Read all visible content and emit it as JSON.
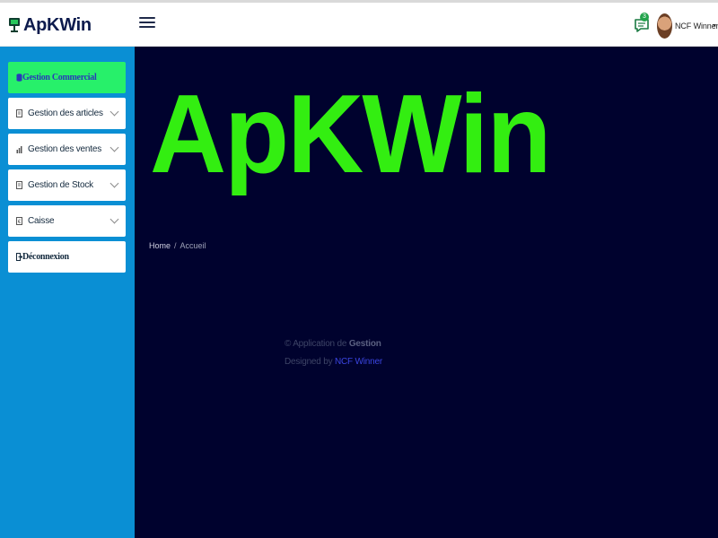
{
  "header": {
    "app_name": "ApKWin",
    "notification_count": "3",
    "user_name": "NCF Winner"
  },
  "sidebar": {
    "items": [
      {
        "label": "Gestion Commercial",
        "icon": "database-icon",
        "active": true,
        "has_submenu": false
      },
      {
        "label": "Gestion des articles",
        "icon": "document-icon",
        "active": false,
        "has_submenu": true
      },
      {
        "label": "Gestion des ventes",
        "icon": "bar-chart-icon",
        "active": false,
        "has_submenu": true
      },
      {
        "label": "Gestion de Stock",
        "icon": "document-icon",
        "active": false,
        "has_submenu": true
      },
      {
        "label": "Caisse",
        "icon": "cash-icon",
        "active": false,
        "has_submenu": true
      },
      {
        "label": "Déconnexion",
        "icon": "logout-icon",
        "active": false,
        "has_submenu": false
      }
    ]
  },
  "main": {
    "hero_title": "ApKWin",
    "breadcrumb": {
      "home": "Home",
      "separator": "/",
      "current": "Accueil"
    },
    "footer": {
      "copyright_prefix": "© Application de",
      "copyright_strong": "Gestion",
      "designed_by": "Designed by",
      "designer": "NCF Winner"
    }
  },
  "colors": {
    "header_bg": "#ffffff",
    "sidebar_bg": "#0a8fd4",
    "active_item_bg": "#27f06a",
    "main_bg": "#00022e",
    "hero_text": "#33ee11",
    "link": "#3a45e0"
  }
}
